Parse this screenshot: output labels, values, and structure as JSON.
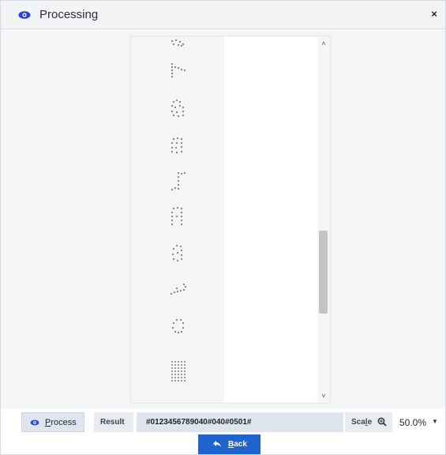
{
  "dialog": {
    "title": "Processing",
    "title_icon": "eye-icon",
    "close_icon": "close-icon",
    "close_glyph": "×"
  },
  "viewer": {
    "image_description_icon": "dot-matrix-image",
    "scroll_up_glyph": "˄",
    "scroll_down_glyph": "˅"
  },
  "toolbar": {
    "process_button": {
      "label_first": "P",
      "label_rest": "rocess",
      "icon": "eye-icon"
    },
    "result_label": "Result",
    "result_value": "#0123456789040#040#0501#",
    "scale_label_first": "Sca",
    "scale_label_u": "l",
    "scale_label_rest": "e",
    "scale_zoom_icon": "zoom-icon",
    "scale_value": "50.0%",
    "scale_caret": "▼",
    "back_button": {
      "label_first": "B",
      "label_rest": "ack",
      "icon": "back-arrow-icon"
    }
  },
  "colors": {
    "accent": "#1f63cf",
    "title_icon": "#2b3fd6",
    "dots": "#7d7d7d"
  }
}
